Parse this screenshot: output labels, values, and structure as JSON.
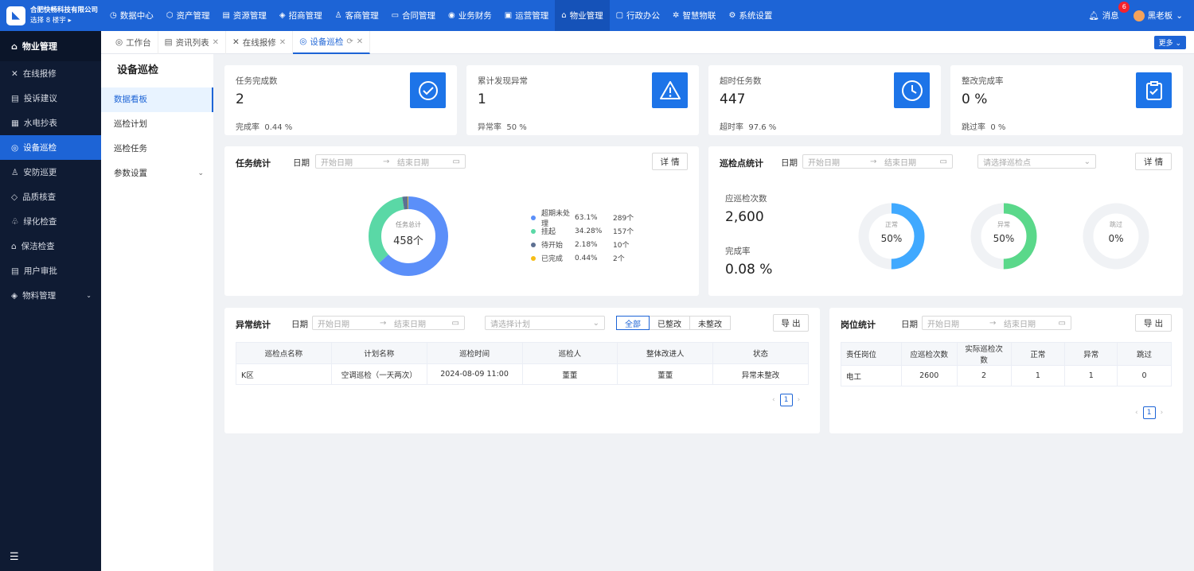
{
  "brand": {
    "company": "合肥快畅科技有限公司",
    "location": "选择 8 楼宇 ▸"
  },
  "topnav": [
    {
      "icon": "◷",
      "label": "数据中心"
    },
    {
      "icon": "⬡",
      "label": "资产管理"
    },
    {
      "icon": "▤",
      "label": "资源管理"
    },
    {
      "icon": "◈",
      "label": "招商管理"
    },
    {
      "icon": "♙",
      "label": "客商管理"
    },
    {
      "icon": "▭",
      "label": "合同管理"
    },
    {
      "icon": "◉",
      "label": "业务财务"
    },
    {
      "icon": "▣",
      "label": "运营管理"
    },
    {
      "icon": "⌂",
      "label": "物业管理"
    },
    {
      "icon": "▢",
      "label": "行政办公"
    },
    {
      "icon": "✲",
      "label": "智慧物联"
    },
    {
      "icon": "⚙",
      "label": "系统设置"
    }
  ],
  "header": {
    "messages_label": "消息",
    "messages_count": "6",
    "user_name": "黑老板"
  },
  "sidebar": {
    "title": "物业管理",
    "items": [
      {
        "icon": "✕",
        "label": "在线报修"
      },
      {
        "icon": "▤",
        "label": "投诉建议"
      },
      {
        "icon": "▦",
        "label": "水电抄表"
      },
      {
        "icon": "◎",
        "label": "设备巡检"
      },
      {
        "icon": "♙",
        "label": "安防巡更"
      },
      {
        "icon": "◇",
        "label": "品质核查"
      },
      {
        "icon": "♧",
        "label": "绿化检查"
      },
      {
        "icon": "⌂",
        "label": "保洁检查"
      },
      {
        "icon": "▤",
        "label": "用户审批"
      },
      {
        "icon": "◈",
        "label": "物料管理"
      }
    ],
    "active_index": 3,
    "collapse_icon": "☰"
  },
  "tabs": [
    {
      "icon": "◎",
      "label": "工作台"
    },
    {
      "icon": "▤",
      "label": "资讯列表"
    },
    {
      "icon": "✕",
      "label": "在线报修"
    },
    {
      "icon": "◎",
      "label": "设备巡检"
    }
  ],
  "more_label": "更多 ⌄",
  "subnav": {
    "title": "设备巡检",
    "items": [
      "数据看板",
      "巡检计划",
      "巡检任务",
      "参数设置"
    ]
  },
  "stats": [
    {
      "label": "任务完成数",
      "value": "2",
      "foot_label": "完成率",
      "foot_value": "0.44 %",
      "icon": "check-circle-icon"
    },
    {
      "label": "累计发现异常",
      "value": "1",
      "foot_label": "异常率",
      "foot_value": "50 %",
      "icon": "warning-icon"
    },
    {
      "label": "超时任务数",
      "value": "447",
      "foot_label": "超时率",
      "foot_value": "97.6 %",
      "icon": "clock-icon"
    },
    {
      "label": "整改完成率",
      "value": "0 %",
      "foot_label": "跳过率",
      "foot_value": "0 %",
      "icon": "clipboard-check-icon"
    }
  ],
  "common": {
    "date_label": "日期",
    "start_ph": "开始日期",
    "end_ph": "结束日期",
    "arrow": "→",
    "detail_btn": "详 情",
    "export_btn": "导 出"
  },
  "task_stats": {
    "title": "任务统计",
    "center_label": "任务总计",
    "center_value": "458个",
    "segments": [
      {
        "name": "超期未处理",
        "percent": "63.1%",
        "count": "289个",
        "value": 289,
        "color": "#5b8ff9"
      },
      {
        "name": "挂起",
        "percent": "34.28%",
        "count": "157个",
        "value": 157,
        "color": "#5ad8a6"
      },
      {
        "name": "待开始",
        "percent": "2.18%",
        "count": "10个",
        "value": 10,
        "color": "#5d7092"
      },
      {
        "name": "已完成",
        "percent": "0.44%",
        "count": "2个",
        "value": 2,
        "color": "#f6bd16"
      }
    ]
  },
  "point_stats": {
    "title": "巡检点统计",
    "select_ph": "请选择巡检点",
    "planned_label": "应巡检次数",
    "planned_value": "2,600",
    "rate_label": "完成率",
    "rate_value": "0.08 %",
    "rings": [
      {
        "label": "正常",
        "value": "50%",
        "fraction": 0.5,
        "color": "#40a9ff"
      },
      {
        "label": "异常",
        "value": "50%",
        "fraction": 0.5,
        "color": "#5ad88a"
      },
      {
        "label": "跳过",
        "value": "0%",
        "fraction": 0,
        "color": "#40a9ff"
      }
    ]
  },
  "anomaly": {
    "title": "异常统计",
    "plan_ph": "请选择计划",
    "filters": [
      "全部",
      "已整改",
      "未整改"
    ],
    "columns": [
      "巡检点名称",
      "计划名称",
      "巡检时间",
      "巡检人",
      "整体改进人",
      "状态"
    ],
    "rows": [
      [
        "K区",
        "空调巡检（一天两次）",
        "2024-08-09 11:00",
        "董董",
        "董董",
        "异常未整改"
      ]
    ],
    "page": "1"
  },
  "post_stats": {
    "title": "岗位统计",
    "columns": [
      "责任岗位",
      "应巡检次数",
      "实际巡检次数",
      "正常",
      "异常",
      "跳过"
    ],
    "rows": [
      [
        "电工",
        "2600",
        "2",
        "1",
        "1",
        "0"
      ]
    ],
    "page": "1"
  }
}
